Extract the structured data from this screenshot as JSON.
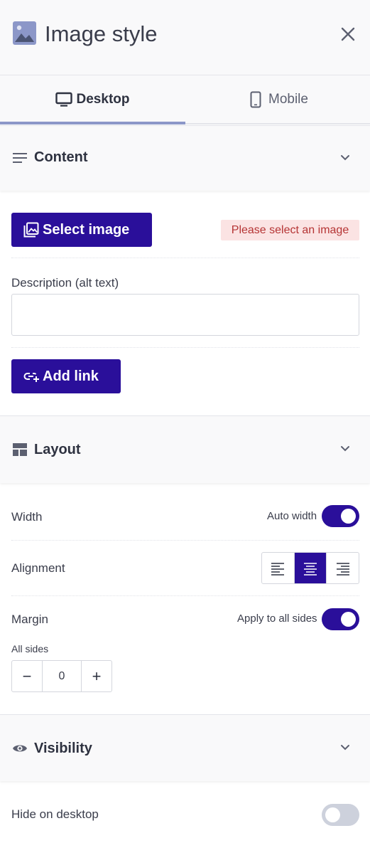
{
  "header": {
    "title": "Image style",
    "icon": "image-icon"
  },
  "tabs": [
    {
      "label": "Desktop",
      "icon": "monitor-icon",
      "active": true
    },
    {
      "label": "Mobile",
      "icon": "phone-icon",
      "active": false
    }
  ],
  "content": {
    "title": "Content",
    "select_image_label": "Select image",
    "error_message": "Please select an image",
    "description_label": "Description (alt text)",
    "description_value": "",
    "add_link_label": "Add link"
  },
  "layout": {
    "title": "Layout",
    "width_label": "Width",
    "auto_width_label": "Auto width",
    "auto_width_on": true,
    "alignment_label": "Alignment",
    "alignment_value": "center",
    "margin_label": "Margin",
    "apply_all_label": "Apply to all sides",
    "apply_all_on": true,
    "all_sides_label": "All sides",
    "margin_value": "0",
    "decrement_symbol": "−",
    "increment_symbol": "+"
  },
  "visibility": {
    "title": "Visibility",
    "hide_desktop_label": "Hide on desktop",
    "hide_desktop_on": false
  },
  "colors": {
    "primary": "#2a0f9a",
    "error_bg": "#fbe3e3",
    "error_text": "#b53434",
    "tab_indicator": "#8c97c8"
  }
}
